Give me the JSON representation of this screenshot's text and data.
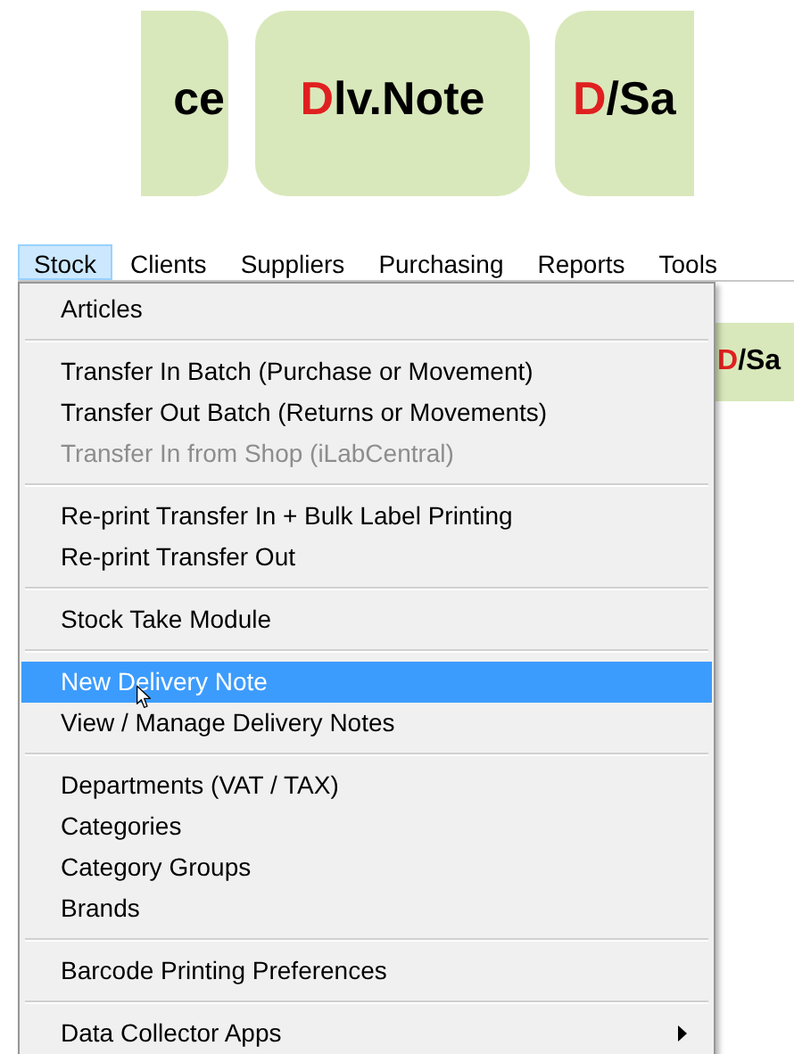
{
  "tiles": [
    {
      "text": "ce"
    },
    {
      "red": "D",
      "text": "lv.Note"
    },
    {
      "red": "D",
      "text": "/Sa"
    }
  ],
  "menu_bar": [
    {
      "label": "Stock",
      "selected": true
    },
    {
      "label": "Clients",
      "selected": false
    },
    {
      "label": "Suppliers",
      "selected": false
    },
    {
      "label": "Purchasing",
      "selected": false
    },
    {
      "label": "Reports",
      "selected": false
    },
    {
      "label": "Tools",
      "selected": false
    }
  ],
  "tile_behind_menu": {
    "red": "D",
    "text": "/Sa"
  },
  "menu": [
    {
      "kind": "item",
      "label": "Articles",
      "selected": false,
      "disabled": false
    },
    {
      "kind": "separator"
    },
    {
      "kind": "item",
      "label": "Transfer In Batch (Purchase or Movement)",
      "selected": false,
      "disabled": false
    },
    {
      "kind": "item",
      "label": "Transfer Out Batch (Returns or Movements)",
      "selected": false,
      "disabled": false
    },
    {
      "kind": "item",
      "label": "Transfer In from Shop (iLabCentral)",
      "selected": false,
      "disabled": true
    },
    {
      "kind": "separator"
    },
    {
      "kind": "item",
      "label": "Re-print Transfer In + Bulk Label Printing",
      "selected": false,
      "disabled": false
    },
    {
      "kind": "item",
      "label": "Re-print Transfer Out",
      "selected": false,
      "disabled": false
    },
    {
      "kind": "separator"
    },
    {
      "kind": "item",
      "label": "Stock Take Module",
      "selected": false,
      "disabled": false
    },
    {
      "kind": "separator"
    },
    {
      "kind": "item",
      "label": "New Delivery Note",
      "selected": true,
      "disabled": false
    },
    {
      "kind": "item",
      "label": "View / Manage Delivery Notes",
      "selected": false,
      "disabled": false
    },
    {
      "kind": "separator"
    },
    {
      "kind": "item",
      "label": "Departments (VAT / TAX)",
      "selected": false,
      "disabled": false
    },
    {
      "kind": "item",
      "label": "Categories",
      "selected": false,
      "disabled": false
    },
    {
      "kind": "item",
      "label": "Category Groups",
      "selected": false,
      "disabled": false
    },
    {
      "kind": "item",
      "label": "Brands",
      "selected": false,
      "disabled": false
    },
    {
      "kind": "separator"
    },
    {
      "kind": "item",
      "label": "Barcode Printing Preferences",
      "selected": false,
      "disabled": false
    },
    {
      "kind": "separator"
    },
    {
      "kind": "submenu",
      "label": "Data Collector Apps",
      "selected": false,
      "disabled": false
    }
  ]
}
